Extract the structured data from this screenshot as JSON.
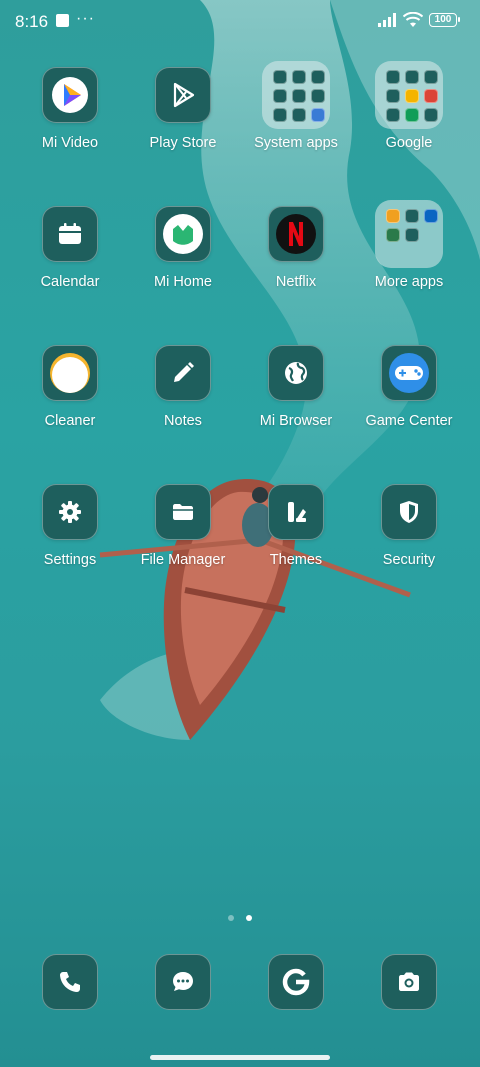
{
  "status_bar": {
    "time": "8:16",
    "overflow": "···",
    "battery": "100"
  },
  "apps": [
    {
      "label": "Mi Video",
      "icon": "mi-video-icon"
    },
    {
      "label": "Play Store",
      "icon": "play-store-icon"
    },
    {
      "label": "System apps",
      "icon": "folder-icon"
    },
    {
      "label": "Google",
      "icon": "folder-icon"
    },
    {
      "label": "Calendar",
      "icon": "calendar-icon"
    },
    {
      "label": "Mi Home",
      "icon": "mi-home-icon"
    },
    {
      "label": "Netflix",
      "icon": "netflix-icon"
    },
    {
      "label": "More apps",
      "icon": "folder-icon"
    },
    {
      "label": "Cleaner",
      "icon": "cleaner-icon"
    },
    {
      "label": "Notes",
      "icon": "notes-icon"
    },
    {
      "label": "Mi Browser",
      "icon": "globe-icon"
    },
    {
      "label": "Game Center",
      "icon": "gamepad-icon"
    },
    {
      "label": "Settings",
      "icon": "gear-icon"
    },
    {
      "label": "File Manager",
      "icon": "folder-file-icon"
    },
    {
      "label": "Themes",
      "icon": "themes-icon"
    },
    {
      "label": "Security",
      "icon": "shield-icon"
    }
  ],
  "dock": [
    {
      "name": "phone",
      "icon": "phone-icon"
    },
    {
      "name": "messages",
      "icon": "message-icon"
    },
    {
      "name": "browser",
      "icon": "g-browser-icon"
    },
    {
      "name": "camera",
      "icon": "camera-icon"
    }
  ],
  "pager": {
    "pages": 2,
    "current": 2
  },
  "colors": {
    "icon_bg": "#1e5f5d",
    "accent": "#2aa3a3"
  }
}
